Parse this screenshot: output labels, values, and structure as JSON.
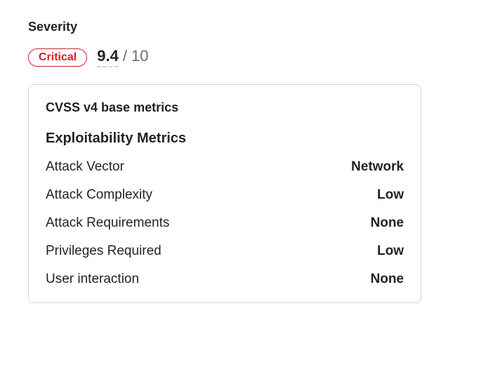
{
  "severity": {
    "title": "Severity",
    "badge": "Critical",
    "badge_color": "#cf222e",
    "score": "9.4",
    "separator": "/",
    "max": "10"
  },
  "metrics": {
    "card_title": "CVSS v4 base metrics",
    "section_title": "Exploitability Metrics",
    "rows": [
      {
        "label": "Attack Vector",
        "value": "Network"
      },
      {
        "label": "Attack Complexity",
        "value": "Low"
      },
      {
        "label": "Attack Requirements",
        "value": "None"
      },
      {
        "label": "Privileges Required",
        "value": "Low"
      },
      {
        "label": "User interaction",
        "value": "None"
      }
    ]
  }
}
